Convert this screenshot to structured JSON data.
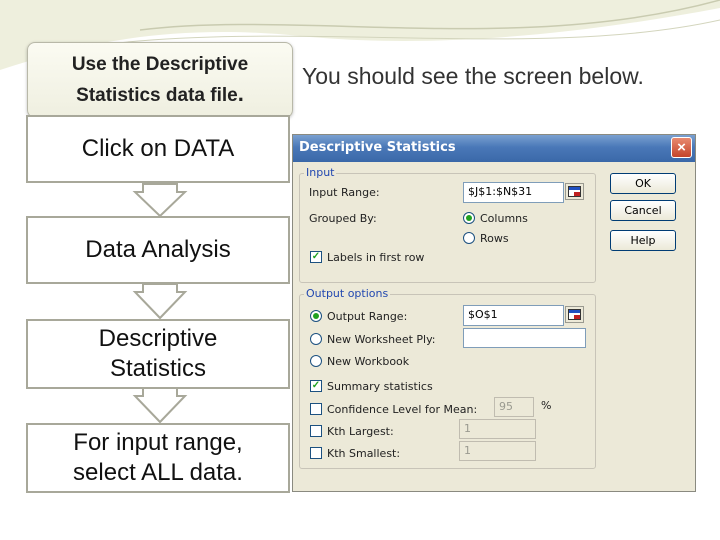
{
  "slide": {
    "title": "Use the Descriptive\nStatistics data file",
    "title_period": ".",
    "caption": "You should see the screen below."
  },
  "steps": [
    "Click on DATA",
    "Data Analysis",
    "Descriptive\nStatistics",
    "For input range,\nselect ALL data."
  ],
  "colors": {
    "title_bar": "#4a78b8",
    "dialog_bg": "#ece9d8",
    "group_label": "#2248b0"
  },
  "dialog": {
    "title": "Descriptive Statistics",
    "close_icon": "×",
    "input": {
      "group_label": "Input",
      "input_range_label": "Input Range:",
      "input_range_value": "$J$1:$N$31",
      "grouped_by_label": "Grouped By:",
      "columns_label": "Columns",
      "rows_label": "Rows",
      "grouped_by_selected": "Columns",
      "labels_first_row_label": "Labels in first row",
      "labels_first_row_checked": true
    },
    "output": {
      "group_label": "Output options",
      "output_range_label": "Output Range:",
      "output_range_value": "$O$1",
      "new_ply_label": "New Worksheet Ply:",
      "new_workbook_label": "New Workbook",
      "summary_label": "Summary statistics",
      "confidence_label": "Confidence Level for Mean:",
      "confidence_value": "95",
      "percent": "%",
      "kth_largest_label": "Kth Largest:",
      "kth_largest_value": "1",
      "kth_smallest_label": "Kth Smallest:",
      "kth_smallest_value": "1"
    },
    "buttons": {
      "ok": "OK",
      "cancel": "Cancel",
      "help": "Help"
    }
  }
}
